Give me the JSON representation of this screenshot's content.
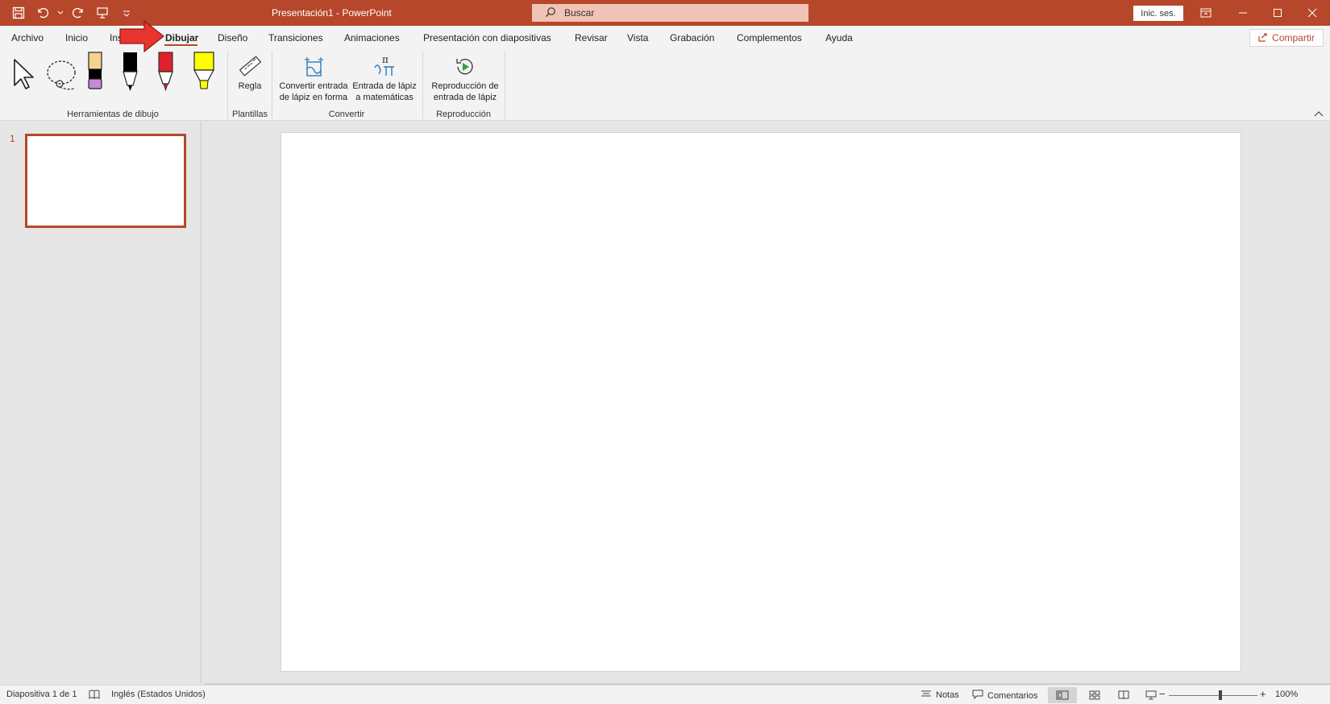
{
  "window": {
    "title": "Presentación1  -  PowerPoint",
    "search_label": "Buscar",
    "signin_label": "Inic. ses.",
    "accent": "#b7472a"
  },
  "ribbon": {
    "tabs": [
      {
        "label": "Archivo"
      },
      {
        "label": "Inicio"
      },
      {
        "label": "Insertar"
      },
      {
        "label": "Dibujar",
        "active": true
      },
      {
        "label": "Diseño"
      },
      {
        "label": "Transiciones"
      },
      {
        "label": "Animaciones"
      },
      {
        "label": "Presentación con diapositivas"
      },
      {
        "label": "Revisar"
      },
      {
        "label": "Vista"
      },
      {
        "label": "Grabación"
      },
      {
        "label": "Complementos"
      },
      {
        "label": "Ayuda"
      }
    ],
    "share_label": "Compartir",
    "groups": {
      "drawing_tools": {
        "label": "Herramientas de dibujo",
        "tools": [
          {
            "name": "select-arrow-icon"
          },
          {
            "name": "lasso-select-icon"
          },
          {
            "name": "eraser-pen-icon",
            "color": "#f5d28e"
          },
          {
            "name": "black-pen-icon",
            "color": "#000000"
          },
          {
            "name": "red-pen-icon",
            "color": "#e0202a"
          },
          {
            "name": "yellow-highlighter-icon",
            "color": "#ffff00"
          }
        ]
      },
      "templates": {
        "label": "Plantillas",
        "ruler_label": "Regla"
      },
      "convert": {
        "label": "Convertir",
        "ink_to_shape_line1": "Convertir entrada",
        "ink_to_shape_line2": "de lápiz en forma",
        "ink_to_math_line1": "Entrada de lápiz",
        "ink_to_math_line2": "a matemáticas"
      },
      "replay": {
        "label": "Reproducción",
        "ink_replay_line1": "Reproducción de",
        "ink_replay_line2": "entrada de lápiz"
      }
    }
  },
  "thumbnails": {
    "slide_number": "1"
  },
  "status": {
    "slide_info": "Diapositiva 1 de 1",
    "language": "Inglés (Estados Unidos)",
    "notes_label": "Notas",
    "comments_label": "Comentarios",
    "zoom_minus": "−",
    "zoom_plus": "+",
    "zoom_level": "100%"
  }
}
